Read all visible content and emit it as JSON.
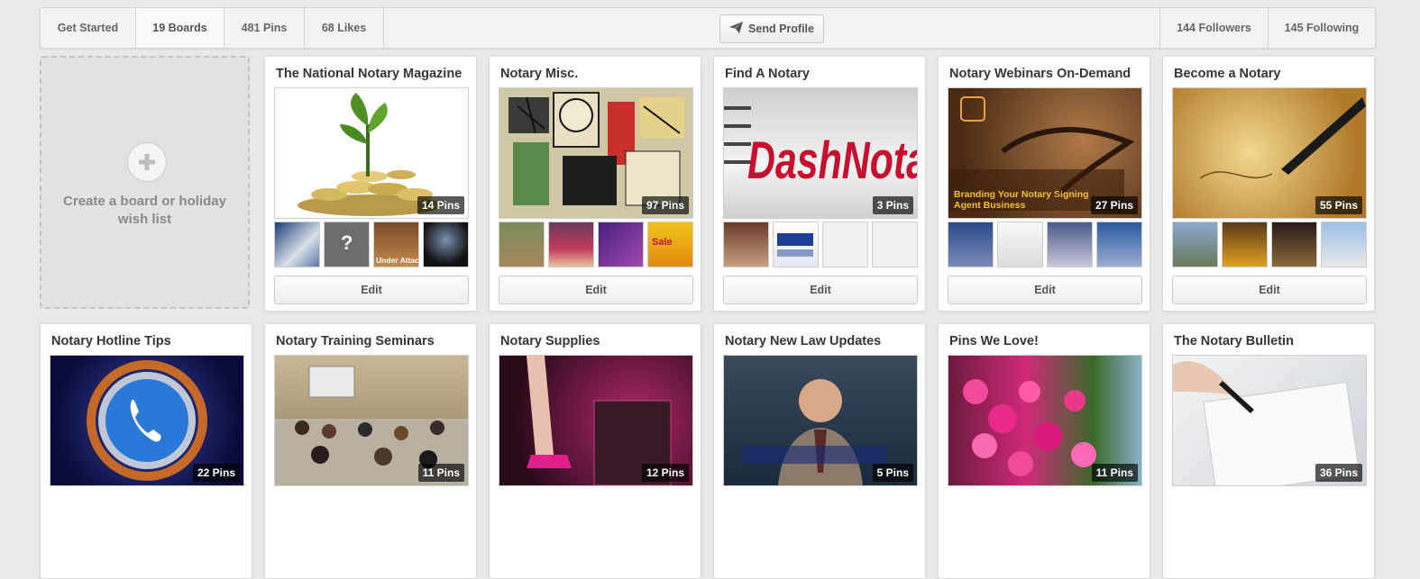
{
  "topbar": {
    "get_started": "Get Started",
    "boards": "19 Boards",
    "pins": "481 Pins",
    "likes": "68 Likes",
    "send_profile": "Send Profile",
    "followers": "144 Followers",
    "following": "145 Following"
  },
  "create_board": {
    "label": "Create a board or holiday wish list"
  },
  "edit_label": "Edit",
  "boards": [
    {
      "title": "The National Notary Magazine",
      "pins": "14 Pins",
      "cover_text": ""
    },
    {
      "title": "Notary Misc.",
      "pins": "97 Pins",
      "cover_text": ""
    },
    {
      "title": "Find A Notary",
      "pins": "3 Pins",
      "cover_text": "DashNota"
    },
    {
      "title": "Notary Webinars On-Demand",
      "pins": "27 Pins",
      "cover_text": "Branding Your Notary Signing Agent Business"
    },
    {
      "title": "Become a Notary",
      "pins": "55 Pins",
      "cover_text": ""
    },
    {
      "title": "Notary Hotline Tips",
      "pins": "22 Pins",
      "cover_text": ""
    },
    {
      "title": "Notary Training Seminars",
      "pins": "11 Pins",
      "cover_text": ""
    },
    {
      "title": "Notary Supplies",
      "pins": "12 Pins",
      "cover_text": ""
    },
    {
      "title": "Notary New Law Updates",
      "pins": "5 Pins",
      "cover_text": ""
    },
    {
      "title": "Pins We Love!",
      "pins": "11 Pins",
      "cover_text": ""
    },
    {
      "title": "The Notary Bulletin",
      "pins": "36 Pins",
      "cover_text": ""
    }
  ],
  "thumb_text": {
    "under_attack": "Under Attack",
    "sale": "Sale"
  },
  "colors": {
    "accent_red": "#c8102e",
    "bg": "#e9e9e9"
  }
}
